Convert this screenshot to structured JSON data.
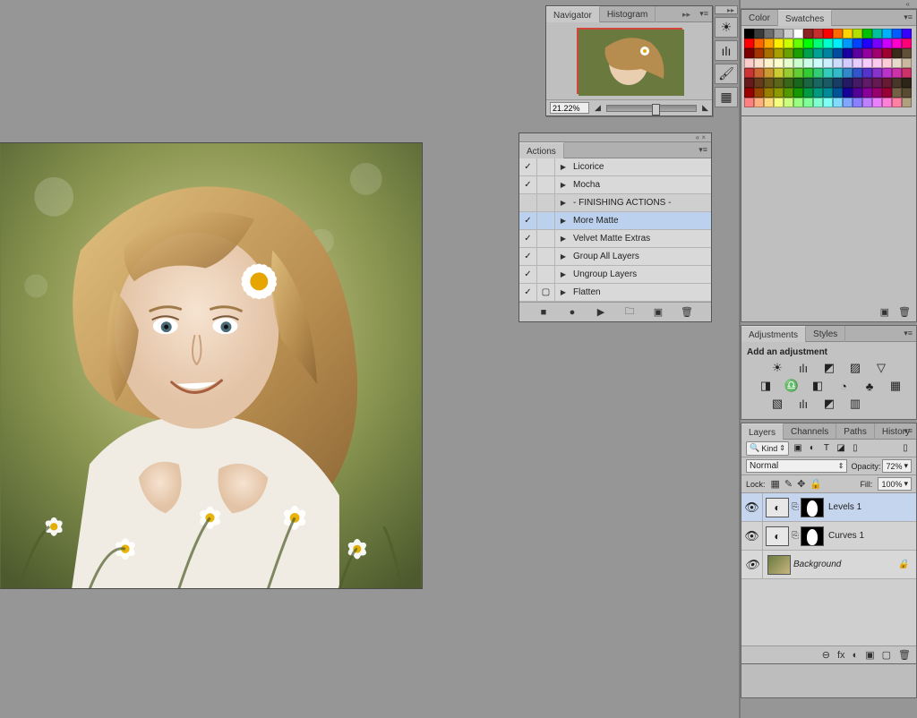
{
  "navigator": {
    "tabs": [
      "Navigator",
      "Histogram"
    ],
    "zoom": "21.22%"
  },
  "dock_icons": [
    "brightness-icon",
    "histogram-icon",
    "brush-icon",
    "swatch-icon"
  ],
  "actions": {
    "tab": "Actions",
    "items": [
      {
        "check": true,
        "label": "Licorice"
      },
      {
        "check": true,
        "label": "Mocha"
      },
      {
        "check": false,
        "label": "- FINISHING ACTIONS -"
      },
      {
        "check": true,
        "label": "More Matte",
        "selected": true
      },
      {
        "check": true,
        "label": "Velvet Matte Extras"
      },
      {
        "check": true,
        "label": "Group All Layers"
      },
      {
        "check": true,
        "label": "Ungroup Layers"
      },
      {
        "check": true,
        "box": true,
        "label": "Flatten"
      }
    ],
    "footer": [
      "■",
      "●",
      "▶",
      "folder",
      "new",
      "trash"
    ]
  },
  "swatches": {
    "tabs": [
      "Color",
      "Swatches"
    ],
    "colors": [
      "#000000",
      "#3a3a3a",
      "#6e6e6e",
      "#a0a0a0",
      "#cfcfcf",
      "#ffffff",
      "#8e2323",
      "#c62e2e",
      "#ff0000",
      "#ff6a00",
      "#ffd400",
      "#b0e000",
      "#00c000",
      "#00c0a0",
      "#00b0ff",
      "#005cff",
      "#3a00ff",
      "#ff0000",
      "#ff6600",
      "#ffaa00",
      "#ffee00",
      "#ccff00",
      "#66ff00",
      "#00ff00",
      "#00ff77",
      "#00ffcc",
      "#00eeff",
      "#0099ff",
      "#0044ff",
      "#2200ff",
      "#7700ff",
      "#cc00ff",
      "#ff00cc",
      "#ff0077",
      "#7a0000",
      "#a33300",
      "#a86f00",
      "#a8a000",
      "#6aa000",
      "#1aa000",
      "#00a04f",
      "#00a095",
      "#0083a0",
      "#004da0",
      "#1a00a0",
      "#5d00a0",
      "#9400a0",
      "#a0006d",
      "#a00030",
      "#3a2a1a",
      "#605038",
      "#ffcccc",
      "#ffe0cc",
      "#fff3cc",
      "#fdffcc",
      "#e6ffcc",
      "#ccffcc",
      "#ccffe6",
      "#ccfffb",
      "#ccf0ff",
      "#ccddff",
      "#d4ccff",
      "#e8ccff",
      "#f9ccff",
      "#ffccf0",
      "#ffccda",
      "#e7dccb",
      "#cbb99f",
      "#cc3333",
      "#cc6633",
      "#cc9933",
      "#cccc33",
      "#99cc33",
      "#66cc33",
      "#33cc33",
      "#33cc77",
      "#33ccbb",
      "#33bbcc",
      "#3388cc",
      "#3355cc",
      "#5533cc",
      "#8833cc",
      "#bb33cc",
      "#cc33aa",
      "#cc3366",
      "#661a1a",
      "#663a1a",
      "#66571a",
      "#5b661a",
      "#3a661a",
      "#1a661a",
      "#1a6642",
      "#1a6660",
      "#1a5a66",
      "#1a3d66",
      "#251a66",
      "#451a66",
      "#601a66",
      "#661a52",
      "#661a34",
      "#473728",
      "#2e2519",
      "#990000",
      "#994400",
      "#997f00",
      "#8d9900",
      "#559900",
      "#159900",
      "#009944",
      "#00997f",
      "#008a99",
      "#005299",
      "#160099",
      "#530099",
      "#880099",
      "#99006f",
      "#990034",
      "#736145",
      "#594a32",
      "#ff8080",
      "#ffb080",
      "#ffdb80",
      "#f7ff80",
      "#ccff80",
      "#99ff80",
      "#80ff99",
      "#80ffd1",
      "#80fff7",
      "#80dbff",
      "#80a6ff",
      "#8a80ff",
      "#bf80ff",
      "#eb80ff",
      "#ff80d6",
      "#ff80a3",
      "#b0a080"
    ]
  },
  "adjustments": {
    "tabs": [
      "Adjustments",
      "Styles"
    ],
    "title": "Add an adjustment",
    "row1_glyphs": [
      "☀",
      "ılı",
      "◩",
      "▨",
      "▽"
    ],
    "row2_glyphs": [
      "◨",
      "♎",
      "◧",
      "◔",
      "♣",
      "▦"
    ],
    "row3_glyphs": [
      "▧",
      "ılı",
      "◩",
      "▥"
    ]
  },
  "layers": {
    "tabs": [
      "Layers",
      "Channels",
      "Paths",
      "History"
    ],
    "kind_label": "Kind",
    "filter_glyphs": [
      "▣",
      "◐",
      "T",
      "◪",
      "▯"
    ],
    "blend_mode": "Normal",
    "opacity_label": "Opacity:",
    "opacity_value": "72%",
    "lock_label": "Lock:",
    "lock_glyphs": [
      "▦",
      "✎",
      "✥",
      "🔒"
    ],
    "fill_label": "Fill:",
    "fill_value": "100%",
    "items": [
      {
        "name": "Levels 1",
        "type": "adjustment",
        "selected": true
      },
      {
        "name": "Curves 1",
        "type": "adjustment"
      },
      {
        "name": "Background",
        "type": "bg"
      }
    ],
    "footer_glyphs": [
      "⊖",
      "fx",
      "◐",
      "▣",
      "▢",
      "🗑"
    ]
  }
}
